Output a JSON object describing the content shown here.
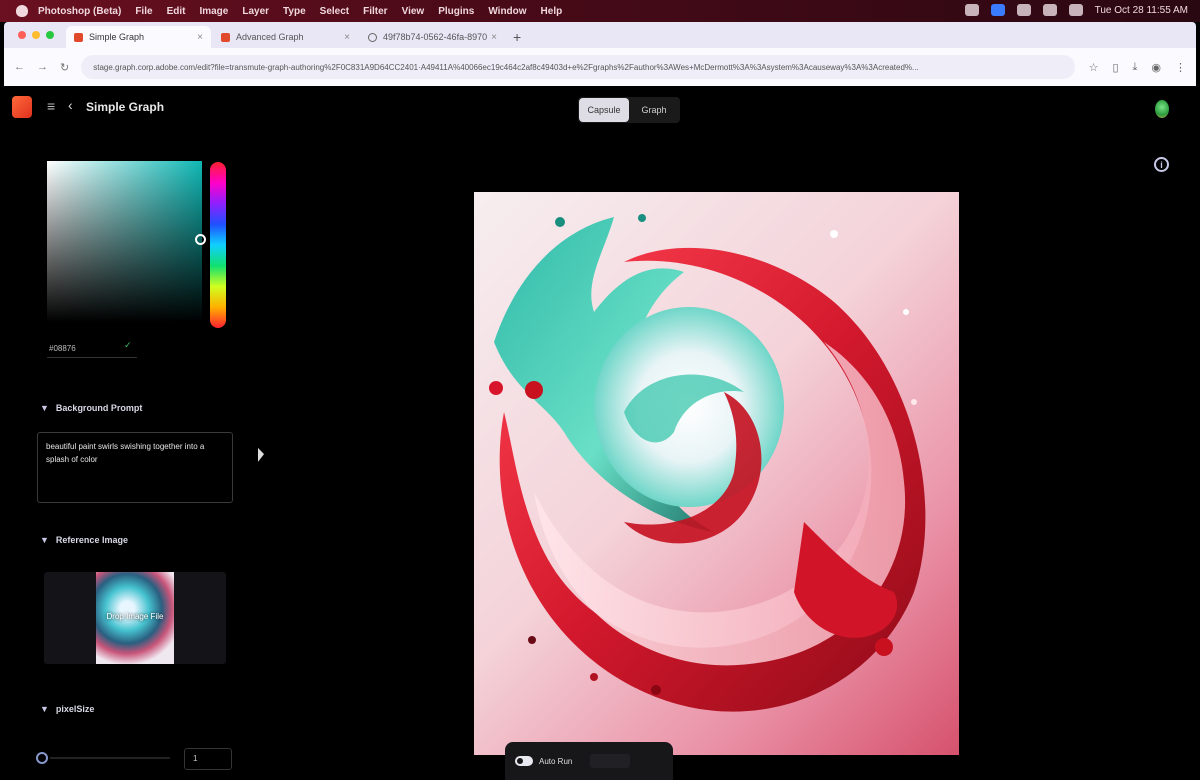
{
  "menubar": {
    "app_name": "Photoshop (Beta)",
    "items": [
      "File",
      "Edit",
      "Image",
      "Layer",
      "Type",
      "Select",
      "Filter",
      "View",
      "Plugins",
      "Window",
      "Help"
    ],
    "clock": "Tue Oct 28  11:55 AM"
  },
  "browser": {
    "tabs": [
      {
        "label": "Simple Graph",
        "icon": "adobe-icon"
      },
      {
        "label": "Advanced Graph",
        "icon": "adobe-icon"
      },
      {
        "label": "49f78b74-0562-46fa-8970",
        "icon": "globe-icon"
      }
    ],
    "url": "stage.graph.corp.adobe.com/edit?file=transmute-graph-authoring%2F0C831A9D64CC2401·A49411A%40066ec19c464c2af8c49403d+e%2Fgraphs%2Fauthor%3AWes+McDermott%3A%3Asystem%3Acauseway%3A%3Acreated%..."
  },
  "app": {
    "title": "Simple Graph",
    "view_tabs": [
      {
        "label": "Capsule",
        "active": true
      },
      {
        "label": "Graph",
        "active": false
      }
    ]
  },
  "color_picker": {
    "hex_value": "#08876",
    "color": "#0fb7b4"
  },
  "sections": {
    "background_prompt": {
      "heading": "Background Prompt",
      "text": "beautiful paint swirls swishing together into a splash of color"
    },
    "reference_image": {
      "heading": "Reference Image",
      "drop_label": "Drop Image File"
    },
    "pixel_size": {
      "heading": "pixelSize",
      "value": "1"
    }
  },
  "toolbar": {
    "auto_run_label": "Auto Run",
    "auto_run_on": true
  }
}
